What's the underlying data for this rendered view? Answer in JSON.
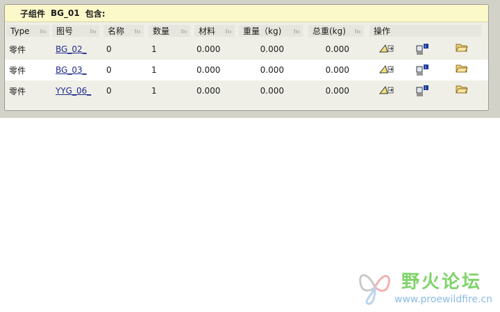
{
  "title": {
    "prefix": "子组件",
    "assembly": "BG_01",
    "suffix": "包含:"
  },
  "columns": [
    "Type",
    "图号",
    "名称",
    "数量",
    "材料",
    "重量（kg)",
    "总重(kg)",
    "操作"
  ],
  "rows": [
    {
      "type": "零件",
      "drawing_no": "BG_02_",
      "name": "0",
      "qty": "1",
      "material": "0.000",
      "weight": "0.000",
      "total_weight": "0.000"
    },
    {
      "type": "零件",
      "drawing_no": "BG_03_",
      "name": "0",
      "qty": "1",
      "material": "0.000",
      "weight": "0.000",
      "total_weight": "0.000"
    },
    {
      "type": "零件",
      "drawing_no": "YYG_06_",
      "name": "0",
      "qty": "1",
      "material": "0.000",
      "weight": "0.000",
      "total_weight": "0.000"
    }
  ],
  "action_icons": [
    "edit-geometry-icon",
    "info-icon",
    "open-folder-icon"
  ],
  "watermark": {
    "text": "野火论坛",
    "url": "www.proewildfire.cn"
  }
}
